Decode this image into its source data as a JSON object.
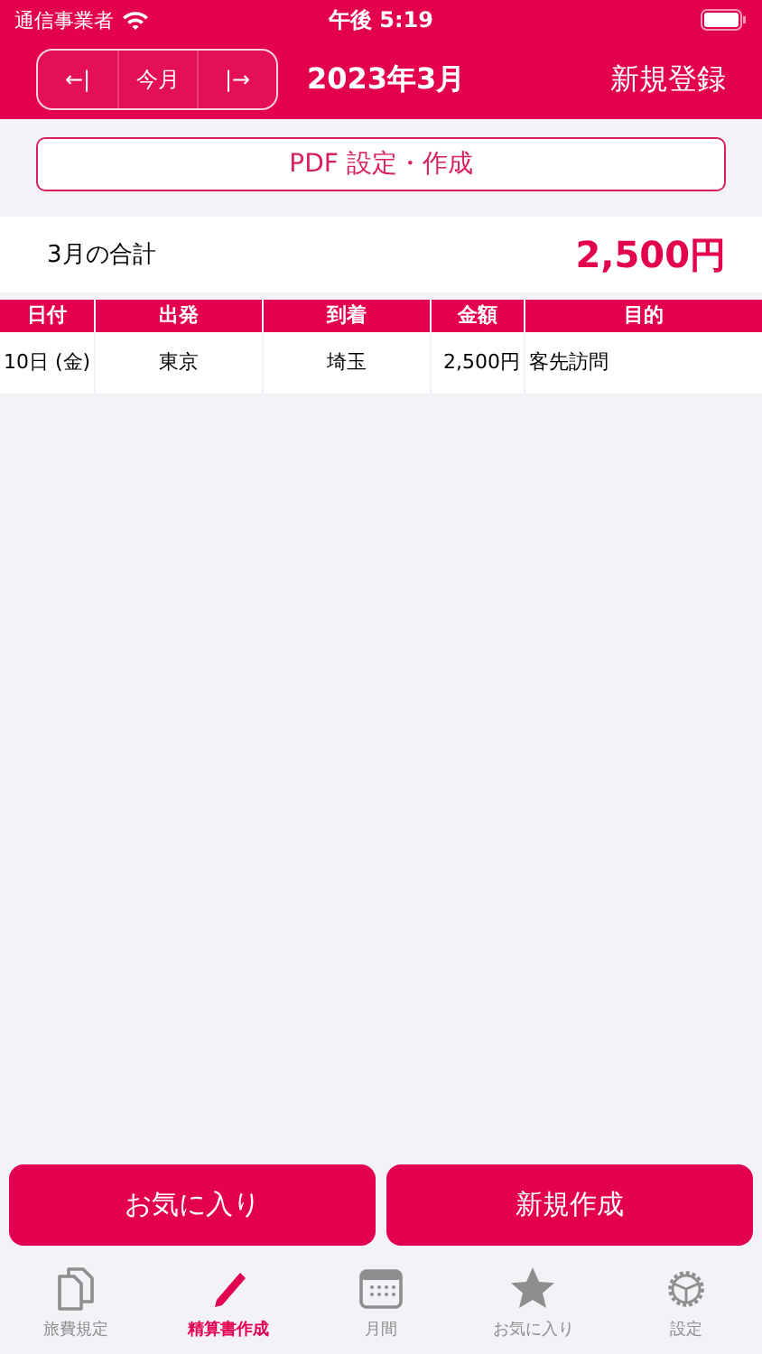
{
  "status_bar": {
    "carrier": "通信事業者",
    "time": "午後 5:19"
  },
  "header": {
    "nav": [
      {
        "label": "←|"
      },
      {
        "label": "今月"
      },
      {
        "label": "|→"
      }
    ],
    "title": "2023年3月",
    "action": "新規登録"
  },
  "pdf_button": "PDF 設定・作成",
  "summary": {
    "label": "3月の合計",
    "total": "2,500円"
  },
  "table": {
    "columns": [
      "日付",
      "出発",
      "到着",
      "金額",
      "目的"
    ],
    "rows": [
      [
        "10日 (金)",
        "東京",
        "埼玉",
        "2,500円",
        "客先訪問"
      ]
    ]
  },
  "buttons": [
    "お気に入り",
    "新規作成"
  ],
  "tab_bar": [
    {
      "label": "旅費規定",
      "kind": "docs",
      "selected": false
    },
    {
      "label": "精算書作成",
      "kind": "pencil",
      "selected": true
    },
    {
      "label": "月間",
      "kind": "calendar",
      "selected": false
    },
    {
      "label": "お気に入り",
      "kind": "star",
      "selected": false
    },
    {
      "label": "設定",
      "kind": "gear",
      "selected": false
    }
  ]
}
